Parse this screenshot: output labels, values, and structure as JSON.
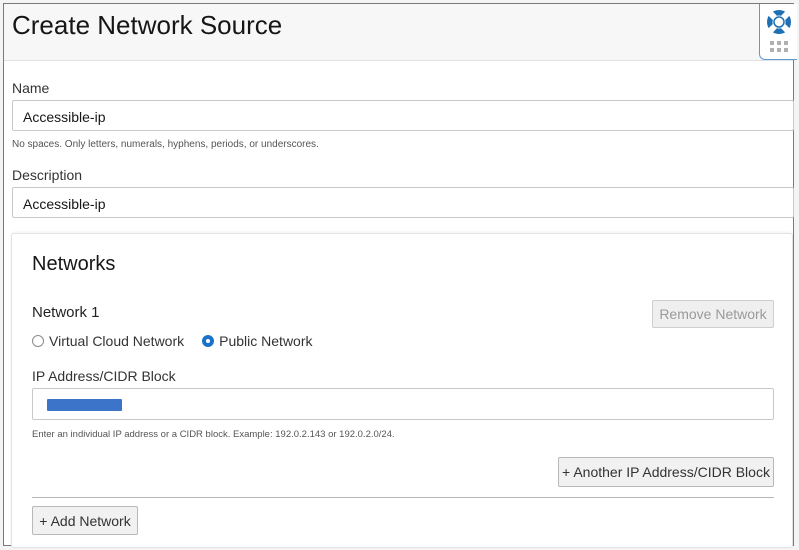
{
  "page": {
    "title": "Create Network Source"
  },
  "help": {
    "icon": "lifebuoy-icon",
    "grid_icon": "grid-dots-icon",
    "accent": "#1f6fb5"
  },
  "form": {
    "name": {
      "label": "Name",
      "value": "Accessible-ip",
      "hint": "No spaces. Only letters, numerals, hyphens, periods, or underscores."
    },
    "description": {
      "label": "Description",
      "value": "Accessible-ip"
    }
  },
  "networks": {
    "title": "Networks",
    "items": [
      {
        "title": "Network 1",
        "remove_label": "Remove Network",
        "types": [
          {
            "label": "Virtual Cloud Network",
            "selected": false
          },
          {
            "label": "Public Network",
            "selected": true
          }
        ],
        "ip_label": "IP Address/CIDR Block",
        "ip_value_redacted": true,
        "ip_hint": "Enter an individual IP address or a CIDR block. Example: 192.0.2.143 or 192.0.2.0/24.",
        "add_ip_label": "+ Another IP Address/CIDR Block"
      }
    ],
    "add_network_label": "+ Add Network"
  },
  "colors": {
    "radio_selected": "#1a73c8",
    "redaction": "#3b74c9"
  }
}
